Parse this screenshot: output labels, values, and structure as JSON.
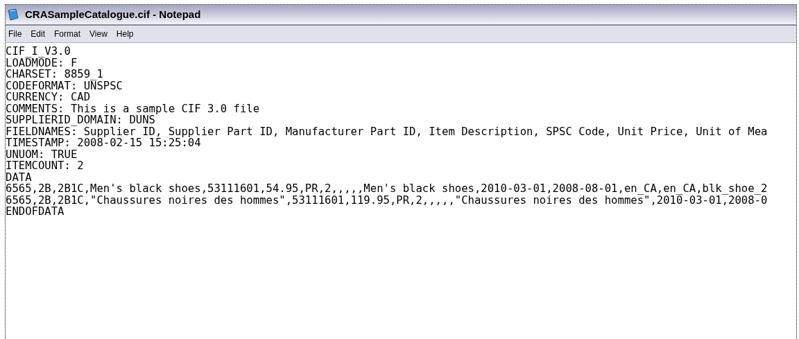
{
  "window": {
    "title": "CRASampleCatalogue.cif - Notepad"
  },
  "menu": [
    "File",
    "Edit",
    "Format",
    "View",
    "Help"
  ],
  "document": {
    "lines": [
      "CIF_I_V3.0",
      "LOADMODE: F",
      "CHARSET: 8859_1",
      "CODEFORMAT: UNSPSC",
      "CURRENCY: CAD",
      "COMMENTS: This is a sample CIF 3.0 file",
      "SUPPLIERID_DOMAIN: DUNS",
      "FIELDNAMES: Supplier ID, Supplier Part ID, Manufacturer Part ID, Item Description, SPSC Code, Unit Price, Unit of Mea",
      "TIMESTAMP: 2008-02-15 15:25:04",
      "UNUOM: TRUE",
      "ITEMCOUNT: 2",
      "DATA",
      "6565,2B,2B1C,Men's black shoes,53111601,54.95,PR,2,,,,,Men's black shoes,2010-03-01,2008-08-01,en_CA,en_CA,blk_shoe_2",
      "6565,2B,2B1C,\"Chaussures noires des hommes\",53111601,119.95,PR,2,,,,,\"Chaussures noires des hommes\",2010-03-01,2008-0",
      "ENDOFDATA"
    ]
  }
}
